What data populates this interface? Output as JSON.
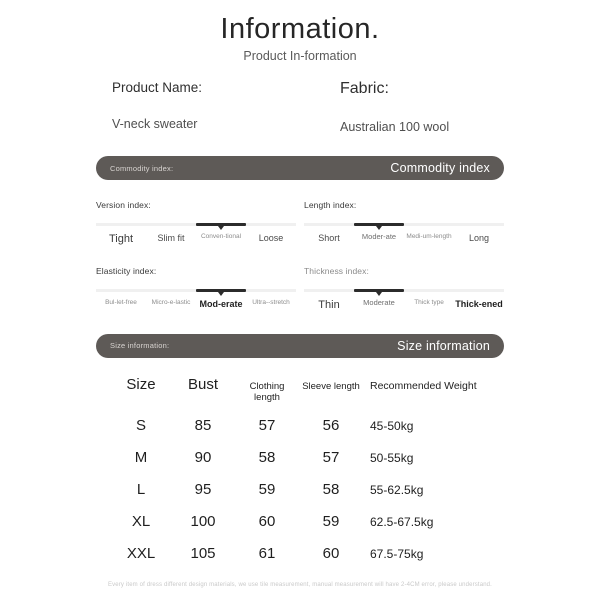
{
  "header": {
    "title": "Information.",
    "subtitle": "Product In-formation"
  },
  "product": {
    "name_label": "Product Name:",
    "name_value": "V-neck sweater",
    "fabric_label": "Fabric:",
    "fabric_value": "Australian 100 wool"
  },
  "commodity_bar": {
    "small_label": "Commodity index:",
    "large_label": "Commodity index"
  },
  "size_bar": {
    "small_label": "Size information:",
    "large_label": "Size information"
  },
  "scales": [
    {
      "title": "Version index:",
      "selected_index": 2,
      "options": [
        "Tight",
        "Slim fit",
        "Conven-tional",
        "Loose"
      ],
      "sizes": [
        "sz-l",
        "sz-m",
        "sz-xs",
        "sz-m"
      ]
    },
    {
      "title": "Length index:",
      "selected_index": 1,
      "options": [
        "Short",
        "Moder-ate",
        "Medi-um-length",
        "Long"
      ],
      "sizes": [
        "sz-m",
        "sz-s",
        "sz-xs",
        "sz-m"
      ]
    },
    {
      "title": "Elasticity index:",
      "selected_index": 2,
      "options": [
        "Bul-let-free",
        "Micro-e-lastic",
        "Mod-erate",
        "Ultra--stretch"
      ],
      "sizes": [
        "sz-xs",
        "sz-xs",
        "sz-m",
        "sz-xs"
      ]
    },
    {
      "title": "Thickness index:",
      "selected_index": 1,
      "options": [
        "Thin",
        "Moderate",
        "Thick type",
        "Thick-ened"
      ],
      "sizes": [
        "sz-l",
        "sz-s",
        "sz-xs",
        "sz-m"
      ]
    }
  ],
  "size_table": {
    "headers": [
      "Size",
      "Bust",
      "Clothing length",
      "Sleeve length",
      "Recommended Weight"
    ],
    "rows": [
      [
        "S",
        "85",
        "57",
        "56",
        "45-50kg"
      ],
      [
        "M",
        "90",
        "58",
        "57",
        "50-55kg"
      ],
      [
        "L",
        "95",
        "59",
        "58",
        "55-62.5kg"
      ],
      [
        "XL",
        "100",
        "60",
        "59",
        "62.5-67.5kg"
      ],
      [
        "XXL",
        "105",
        "61",
        "60",
        "67.5-75kg"
      ]
    ]
  },
  "footer": {
    "note": "Every item of dress different design materials, we use tile measurement, manual measurement will have 2-4CM error, please understand."
  },
  "colors": {
    "bar_gray": "#5e5a57",
    "active_segment": "#2b2b2b",
    "track": "#f0f0f0"
  }
}
